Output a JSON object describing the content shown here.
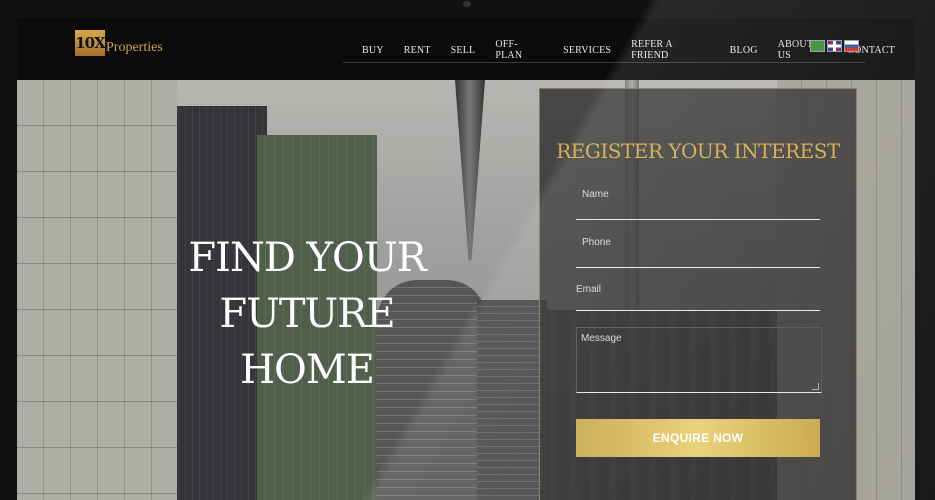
{
  "logo": {
    "mark": "10X",
    "text": "Properties"
  },
  "nav": {
    "items": [
      "BUY",
      "RENT",
      "SELL",
      "OFF-PLAN",
      "SERVICES",
      "REFER A FRIEND",
      "BLOG",
      "ABOUT US",
      "CONTACT"
    ]
  },
  "flags": [
    "saudi-arabia-flag",
    "uk-flag",
    "russia-flag"
  ],
  "hero": {
    "title_line1": "FIND YOUR FUTURE",
    "title_line2": "HOME"
  },
  "form": {
    "title": "REGISTER YOUR INTEREST",
    "name_placeholder": "Name",
    "phone_placeholder": "Phone",
    "email_placeholder": "Email",
    "message_placeholder": "Message",
    "submit_label": "ENQUIRE NOW"
  },
  "colors": {
    "accent": "#d6a94a",
    "button": "#e0c262",
    "topbar": "#0b0b0b"
  }
}
